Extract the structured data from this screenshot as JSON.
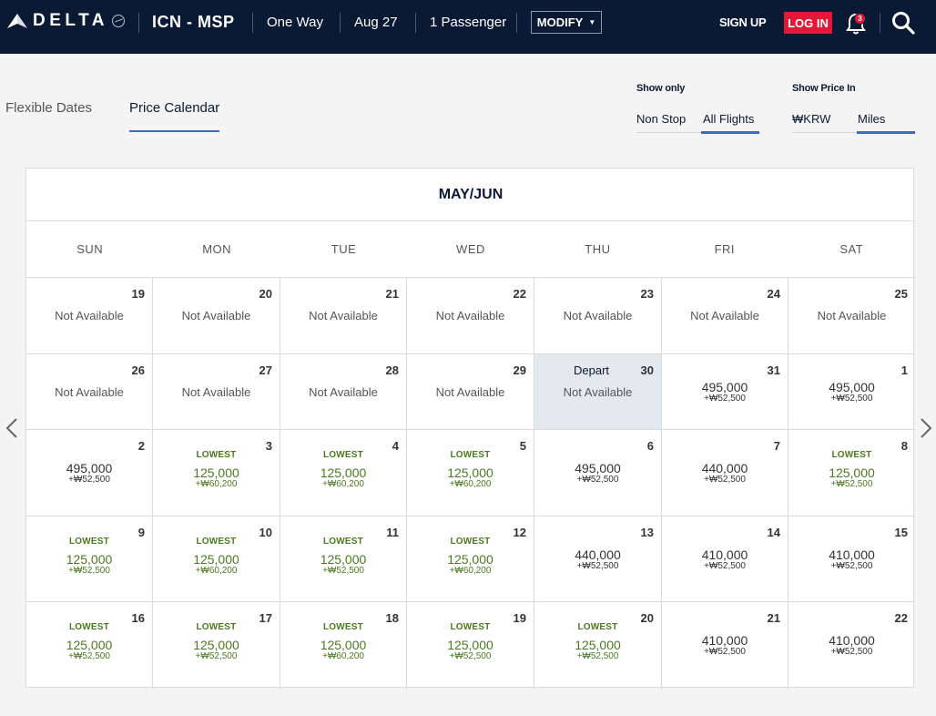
{
  "header": {
    "brand": "DELTA",
    "route": "ICN - MSP",
    "trip_type": "One Way",
    "date": "Aug 27",
    "passengers": "1 Passenger",
    "modify_label": "MODIFY",
    "signup_label": "SIGN UP",
    "login_label": "LOG IN",
    "notification_count": "3"
  },
  "tabs": [
    {
      "label": "Flexible Dates",
      "active": false
    },
    {
      "label": "Price Calendar",
      "active": true
    }
  ],
  "filters": {
    "show_only": {
      "label": "Show only",
      "options": [
        "Non Stop",
        "All Flights"
      ],
      "selected": "All Flights"
    },
    "show_price_in": {
      "label": "Show Price In",
      "options": [
        "₩KRW",
        "Miles"
      ],
      "selected": "Miles"
    }
  },
  "calendar": {
    "month_label": "MAY/JUN",
    "days_of_week": [
      "SUN",
      "MON",
      "TUE",
      "WED",
      "THU",
      "FRI",
      "SAT"
    ],
    "not_available_text": "Not Available",
    "lowest_text": "LOWEST",
    "depart_text": "Depart",
    "weeks": [
      [
        {
          "day": "19",
          "status": "na"
        },
        {
          "day": "20",
          "status": "na"
        },
        {
          "day": "21",
          "status": "na"
        },
        {
          "day": "22",
          "status": "na"
        },
        {
          "day": "23",
          "status": "na"
        },
        {
          "day": "24",
          "status": "na"
        },
        {
          "day": "25",
          "status": "na"
        }
      ],
      [
        {
          "day": "26",
          "status": "na"
        },
        {
          "day": "27",
          "status": "na"
        },
        {
          "day": "28",
          "status": "na"
        },
        {
          "day": "29",
          "status": "na"
        },
        {
          "day": "30",
          "status": "na",
          "depart": true
        },
        {
          "day": "31",
          "status": "price",
          "price": "495,000",
          "fee": "+₩52,500"
        },
        {
          "day": "1",
          "status": "price",
          "price": "495,000",
          "fee": "+₩52,500"
        }
      ],
      [
        {
          "day": "2",
          "status": "price",
          "price": "495,000",
          "fee": "+₩52,500"
        },
        {
          "day": "3",
          "status": "price",
          "lowest": true,
          "price": "125,000",
          "fee": "+₩60,200"
        },
        {
          "day": "4",
          "status": "price",
          "lowest": true,
          "price": "125,000",
          "fee": "+₩60,200"
        },
        {
          "day": "5",
          "status": "price",
          "lowest": true,
          "price": "125,000",
          "fee": "+₩60,200"
        },
        {
          "day": "6",
          "status": "price",
          "price": "495,000",
          "fee": "+₩52,500"
        },
        {
          "day": "7",
          "status": "price",
          "price": "440,000",
          "fee": "+₩52,500"
        },
        {
          "day": "8",
          "status": "price",
          "lowest": true,
          "price": "125,000",
          "fee": "+₩52,500"
        }
      ],
      [
        {
          "day": "9",
          "status": "price",
          "lowest": true,
          "price": "125,000",
          "fee": "+₩52,500"
        },
        {
          "day": "10",
          "status": "price",
          "lowest": true,
          "price": "125,000",
          "fee": "+₩60,200"
        },
        {
          "day": "11",
          "status": "price",
          "lowest": true,
          "price": "125,000",
          "fee": "+₩52,500"
        },
        {
          "day": "12",
          "status": "price",
          "lowest": true,
          "price": "125,000",
          "fee": "+₩60,200"
        },
        {
          "day": "13",
          "status": "price",
          "price": "440,000",
          "fee": "+₩52,500"
        },
        {
          "day": "14",
          "status": "price",
          "price": "410,000",
          "fee": "+₩52,500"
        },
        {
          "day": "15",
          "status": "price",
          "price": "410,000",
          "fee": "+₩52,500"
        }
      ],
      [
        {
          "day": "16",
          "status": "price",
          "lowest": true,
          "price": "125,000",
          "fee": "+₩52,500"
        },
        {
          "day": "17",
          "status": "price",
          "lowest": true,
          "price": "125,000",
          "fee": "+₩52,500"
        },
        {
          "day": "18",
          "status": "price",
          "lowest": true,
          "price": "125,000",
          "fee": "+₩60,200"
        },
        {
          "day": "19",
          "status": "price",
          "lowest": true,
          "price": "125,000",
          "fee": "+₩52,500"
        },
        {
          "day": "20",
          "status": "price",
          "lowest": true,
          "price": "125,000",
          "fee": "+₩52,500"
        },
        {
          "day": "21",
          "status": "price",
          "price": "410,000",
          "fee": "+₩52,500"
        },
        {
          "day": "22",
          "status": "price",
          "price": "410,000",
          "fee": "+₩52,500"
        }
      ]
    ]
  },
  "colors": {
    "header_bg": "#0b1a34",
    "accent": "#3a6fb8",
    "login": "#e31837",
    "lowest": "#4a7a1e",
    "selected_bg": "#e4e8ef"
  },
  "icons": [
    "delta-widget-logo-icon",
    "globe-icon",
    "caret-down-icon",
    "bell-icon",
    "search-icon",
    "prev-arrow-icon",
    "next-arrow-icon"
  ]
}
